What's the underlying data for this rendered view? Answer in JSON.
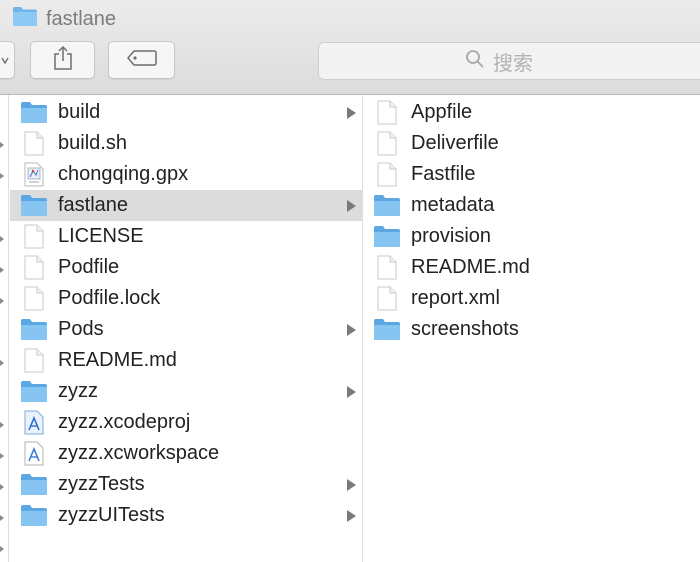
{
  "window": {
    "title": "fastlane"
  },
  "toolbar": {
    "search_placeholder": "搜索"
  },
  "columns": [
    {
      "items": [
        {
          "name": "build",
          "icon": "folder-icon",
          "folder": true,
          "selected": false
        },
        {
          "name": "build.sh",
          "icon": "document-icon",
          "folder": false,
          "selected": false
        },
        {
          "name": "chongqing.gpx",
          "icon": "gpx-file-icon",
          "folder": false,
          "selected": false
        },
        {
          "name": "fastlane",
          "icon": "folder-icon",
          "folder": true,
          "selected": true
        },
        {
          "name": "LICENSE",
          "icon": "document-icon",
          "folder": false,
          "selected": false
        },
        {
          "name": "Podfile",
          "icon": "document-icon",
          "folder": false,
          "selected": false
        },
        {
          "name": "Podfile.lock",
          "icon": "document-icon",
          "folder": false,
          "selected": false
        },
        {
          "name": "Pods",
          "icon": "folder-icon",
          "folder": true,
          "selected": false
        },
        {
          "name": "README.md",
          "icon": "document-icon",
          "folder": false,
          "selected": false
        },
        {
          "name": "zyzz",
          "icon": "folder-icon",
          "folder": true,
          "selected": false
        },
        {
          "name": "zyzz.xcodeproj",
          "icon": "xcodeproj-icon",
          "folder": false,
          "selected": false
        },
        {
          "name": "zyzz.xcworkspace",
          "icon": "xcworkspace-icon",
          "folder": false,
          "selected": false
        },
        {
          "name": "zyzzTests",
          "icon": "folder-icon",
          "folder": true,
          "selected": false
        },
        {
          "name": "zyzzUITests",
          "icon": "folder-icon",
          "folder": true,
          "selected": false
        }
      ]
    },
    {
      "items": [
        {
          "name": "Appfile",
          "icon": "document-icon",
          "folder": false,
          "selected": false
        },
        {
          "name": "Deliverfile",
          "icon": "document-icon",
          "folder": false,
          "selected": false
        },
        {
          "name": "Fastfile",
          "icon": "document-icon",
          "folder": false,
          "selected": false
        },
        {
          "name": "metadata",
          "icon": "folder-icon",
          "folder": true,
          "selected": false
        },
        {
          "name": "provision",
          "icon": "folder-icon",
          "folder": true,
          "selected": false
        },
        {
          "name": "README.md",
          "icon": "document-icon",
          "folder": false,
          "selected": false
        },
        {
          "name": "report.xml",
          "icon": "document-icon",
          "folder": false,
          "selected": false
        },
        {
          "name": "screenshots",
          "icon": "folder-icon",
          "folder": true,
          "selected": false
        }
      ]
    }
  ]
}
